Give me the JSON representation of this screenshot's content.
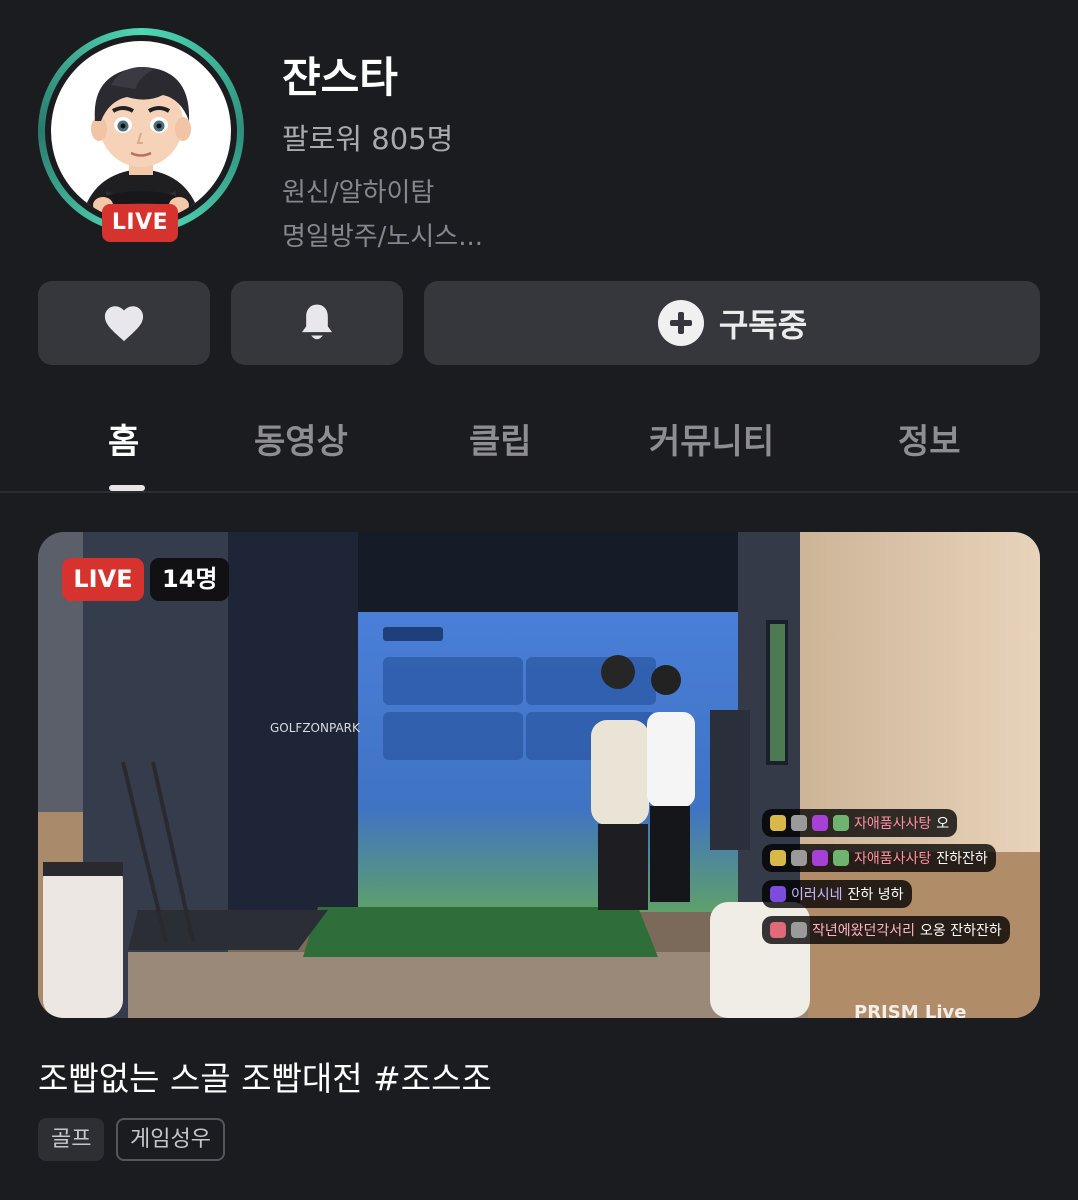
{
  "profile": {
    "name": "쟌스타",
    "followers": "팔로워 805명",
    "description": [
      "원신/알하이탐",
      "명일방주/노시스..."
    ],
    "live_badge": "LIVE"
  },
  "actions": {
    "like_icon": "heart-icon",
    "alarm_icon": "bell-icon",
    "subscribe_label": "구독중"
  },
  "tabs": [
    {
      "label": "홈",
      "active": true
    },
    {
      "label": "동영상",
      "active": false
    },
    {
      "label": "클립",
      "active": false
    },
    {
      "label": "커뮤니티",
      "active": false
    },
    {
      "label": "정보",
      "active": false
    }
  ],
  "live_stream": {
    "live_badge": "LIVE",
    "viewers": "14명",
    "title": "조빱없는 스골 조빱대전 #조스조",
    "tags": [
      "골프",
      "게임성우"
    ],
    "overlay_chat": [
      {
        "nick": "자애품사사탕",
        "text": "오"
      },
      {
        "nick": "자애품사사탕",
        "text": "잔하잔하"
      },
      {
        "nick": "이러시네",
        "text": "잔하 녕하"
      },
      {
        "nick": "작년에왔던각서리",
        "text": "오옹 잔하잔하"
      }
    ],
    "scene_text": {
      "brand": "GOLFZONPARK",
      "watermark": "PRISM Live"
    }
  },
  "colors": {
    "background": "#1b1c20",
    "button": "#36373c",
    "live_red": "#d6322e",
    "ring_green": "#4fd8b4"
  }
}
